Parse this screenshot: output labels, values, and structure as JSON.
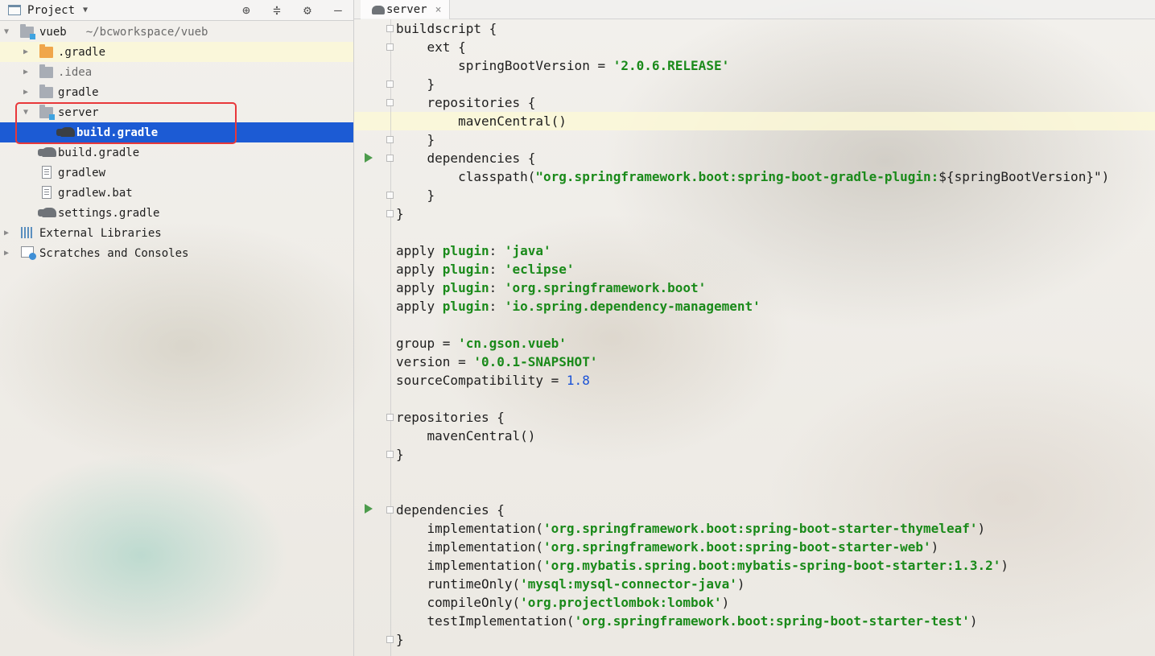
{
  "project_panel": {
    "title": "Project",
    "tools": {
      "locate": "⊕",
      "collapse": "≑",
      "settings": "⚙",
      "hide": "—"
    },
    "tree": [
      {
        "label": "vueb",
        "path": "~/bcworkspace/vueb",
        "icon": "module-folder-icon",
        "expanded": true
      },
      {
        "label": ".gradle",
        "icon": "orange-folder-icon",
        "expanded": false
      },
      {
        "label": ".idea",
        "icon": "folder-icon",
        "expanded": false
      },
      {
        "label": "gradle",
        "icon": "folder-icon",
        "expanded": false
      },
      {
        "label": "server",
        "icon": "module-folder-icon",
        "expanded": true
      },
      {
        "label": "build.gradle",
        "icon": "gradle-icon",
        "selected": true
      },
      {
        "label": "build.gradle",
        "icon": "gradle-icon"
      },
      {
        "label": "gradlew",
        "icon": "text-file-icon"
      },
      {
        "label": "gradlew.bat",
        "icon": "text-file-icon"
      },
      {
        "label": "settings.gradle",
        "icon": "gradle-icon"
      },
      {
        "label": "External Libraries",
        "icon": "libraries-icon",
        "expanded": false
      },
      {
        "label": "Scratches and Consoles",
        "icon": "scratches-icon",
        "expanded": false
      }
    ]
  },
  "editor": {
    "tab": {
      "label": "server",
      "close": "×"
    },
    "lines": [
      [
        {
          "t": "buildscript {"
        }
      ],
      [
        {
          "t": "    ext {"
        }
      ],
      [
        {
          "t": "        springBootVersion = "
        },
        {
          "t": "'2.0.6.RELEASE'",
          "c": "str"
        }
      ],
      [
        {
          "t": "    }"
        }
      ],
      [
        {
          "t": "    repositories {"
        }
      ],
      [
        {
          "t": "        mavenCentral()"
        }
      ],
      [
        {
          "t": "    }"
        }
      ],
      [
        {
          "t": "    dependencies {"
        }
      ],
      [
        {
          "t": "        classpath("
        },
        {
          "t": "\"org.springframework.boot:spring-boot-gradle-plugin:",
          "c": "str"
        },
        {
          "t": "${springBootVersion}\")"
        }
      ],
      [
        {
          "t": "    }"
        }
      ],
      [
        {
          "t": "}"
        }
      ],
      [
        {
          "t": ""
        }
      ],
      [
        {
          "t": "apply "
        },
        {
          "t": "plugin",
          "c": "kw"
        },
        {
          "t": ": "
        },
        {
          "t": "'java'",
          "c": "str"
        }
      ],
      [
        {
          "t": "apply "
        },
        {
          "t": "plugin",
          "c": "kw"
        },
        {
          "t": ": "
        },
        {
          "t": "'eclipse'",
          "c": "str"
        }
      ],
      [
        {
          "t": "apply "
        },
        {
          "t": "plugin",
          "c": "kw"
        },
        {
          "t": ": "
        },
        {
          "t": "'org.springframework.boot'",
          "c": "str"
        }
      ],
      [
        {
          "t": "apply "
        },
        {
          "t": "plugin",
          "c": "kw"
        },
        {
          "t": ": "
        },
        {
          "t": "'io.spring.dependency-management'",
          "c": "str"
        }
      ],
      [
        {
          "t": ""
        }
      ],
      [
        {
          "t": "group = "
        },
        {
          "t": "'cn.gson.vueb'",
          "c": "str"
        }
      ],
      [
        {
          "t": "version = "
        },
        {
          "t": "'0.0.1-SNAPSHOT'",
          "c": "str"
        }
      ],
      [
        {
          "t": "sourceCompatibility = "
        },
        {
          "t": "1.8",
          "c": "num"
        }
      ],
      [
        {
          "t": ""
        }
      ],
      [
        {
          "t": "repositories {"
        }
      ],
      [
        {
          "t": "    mavenCentral()"
        }
      ],
      [
        {
          "t": "}"
        }
      ],
      [
        {
          "t": ""
        }
      ],
      [
        {
          "t": ""
        }
      ],
      [
        {
          "t": "dependencies {"
        }
      ],
      [
        {
          "t": "    implementation("
        },
        {
          "t": "'org.springframework.boot:spring-boot-starter-thymeleaf'",
          "c": "str"
        },
        {
          "t": ")"
        }
      ],
      [
        {
          "t": "    implementation("
        },
        {
          "t": "'org.springframework.boot:spring-boot-starter-web'",
          "c": "str"
        },
        {
          "t": ")"
        }
      ],
      [
        {
          "t": "    implementation("
        },
        {
          "t": "'org.mybatis.spring.boot:mybatis-spring-boot-starter:1.3.2'",
          "c": "str"
        },
        {
          "t": ")"
        }
      ],
      [
        {
          "t": "    runtimeOnly("
        },
        {
          "t": "'mysql:mysql-connector-java'",
          "c": "str"
        },
        {
          "t": ")"
        }
      ],
      [
        {
          "t": "    compileOnly("
        },
        {
          "t": "'org.projectlombok:lombok'",
          "c": "str"
        },
        {
          "t": ")"
        }
      ],
      [
        {
          "t": "    testImplementation("
        },
        {
          "t": "'org.springframework.boot:spring-boot-starter-test'",
          "c": "str"
        },
        {
          "t": ")"
        }
      ],
      [
        {
          "t": "}"
        }
      ]
    ]
  }
}
